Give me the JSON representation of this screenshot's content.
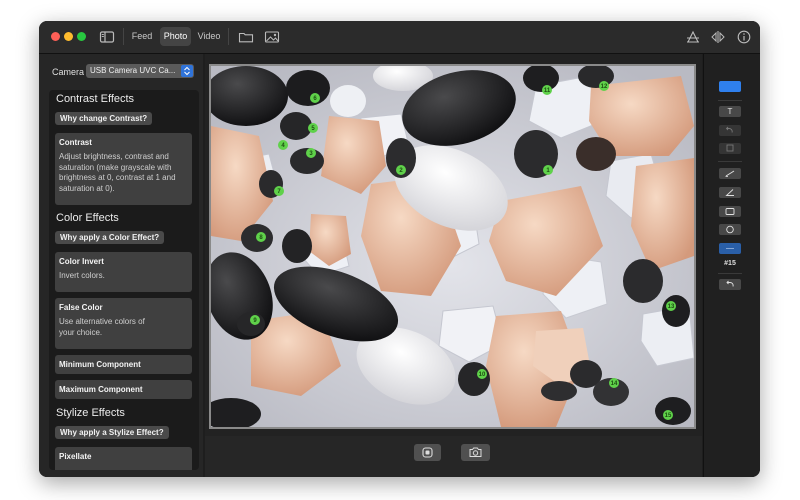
{
  "toolbar": {
    "tabs": [
      {
        "label": "Feed"
      },
      {
        "label": "Photo"
      },
      {
        "label": "Video"
      }
    ]
  },
  "sidebar": {
    "camera_label": "Camera",
    "camera_value": "USB Camera UVC Ca...",
    "sections": [
      {
        "title": "Contrast Effects",
        "why_label": "Why change Contrast?",
        "cards": [
          {
            "title": "Contrast",
            "description": "Adjust brightness, contrast and saturation (make grayscale with brightness at 0, contrast at 1 and saturation at 0)."
          }
        ]
      },
      {
        "title": "Color Effects",
        "why_label": "Why apply a Color Effect?",
        "cards": [
          {
            "title": "Color Invert",
            "description": "Invert colors."
          },
          {
            "title": "False Color",
            "description": "Use alternative colors of your choice."
          },
          {
            "title": "Minimum Component"
          },
          {
            "title": "Maximum Component"
          }
        ]
      },
      {
        "title": "Stylize Effects",
        "why_label": "Why apply a Stylize Effect?",
        "cards": [
          {
            "title": "Pixellate"
          }
        ]
      }
    ]
  },
  "annotation_tools": {
    "text_tool_label": "T",
    "current_marker": "#15",
    "accent_color": "#2f80ed"
  },
  "markers": [
    "1",
    "2",
    "3",
    "4",
    "5",
    "6",
    "7",
    "8",
    "9",
    "10",
    "11",
    "12",
    "13",
    "14",
    "15"
  ],
  "colors": {
    "marker_fill": "#5fd14a",
    "selected_tab": "#444444"
  }
}
